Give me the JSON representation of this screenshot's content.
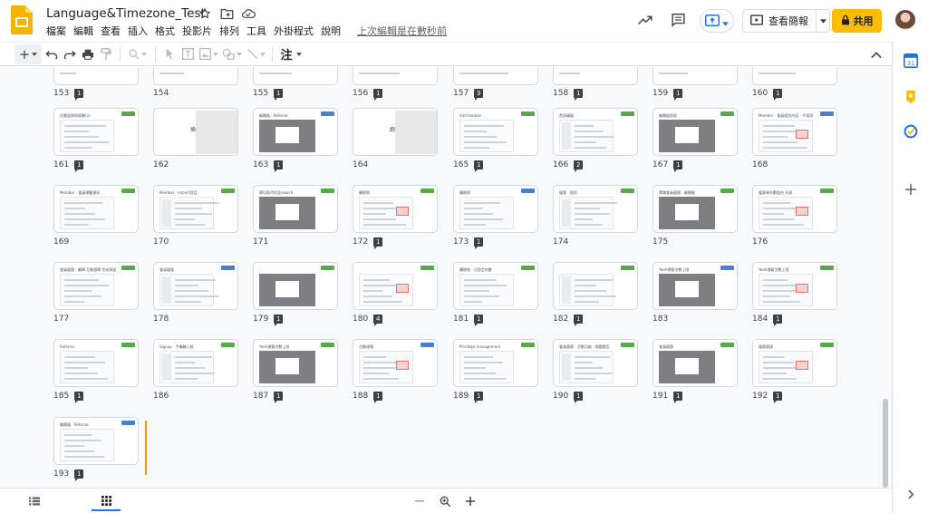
{
  "app": {
    "title": "Language&Timezone_Test",
    "last_edit": "上次編輯是在數秒前",
    "menu": [
      "檔案",
      "編輯",
      "查看",
      "插入",
      "格式",
      "投影片",
      "排列",
      "工具",
      "外掛程式",
      "說明"
    ]
  },
  "header": {
    "slideshow_label": "查看簡報",
    "share_label": "共用"
  },
  "toolbar": {
    "add_label": "+",
    "notes_label": "注"
  },
  "colors": {
    "accent": "#1a73e8",
    "share_button": "#fbbc04",
    "slides_logo": "#f4b400",
    "badge_green": "#57a847",
    "insert_line": "#f29900"
  },
  "icons": [
    "slides-logo-icon",
    "star-icon",
    "move-folder-icon",
    "cloud-status-icon",
    "activity-trend-icon",
    "comment-icon",
    "present-icon",
    "chevron-down-icon",
    "slideshow-icon",
    "lock-icon",
    "undo-icon",
    "redo-icon",
    "print-icon",
    "paint-format-icon",
    "zoom-icon",
    "select-icon",
    "textbox-icon",
    "image-icon",
    "shape-icon",
    "line-icon",
    "collapse-icon",
    "filmstrip-view-icon",
    "grid-view-icon",
    "zoom-out-icon",
    "zoom-in-icon",
    "calendar-icon",
    "keep-icon",
    "tasks-icon",
    "add-icon",
    "expand-panel-icon"
  ],
  "slides": [
    {
      "num": "153",
      "notes": "1"
    },
    {
      "num": "154",
      "notes": ""
    },
    {
      "num": "155",
      "notes": "1"
    },
    {
      "num": "156",
      "notes": "1"
    },
    {
      "num": "157",
      "notes": "3"
    },
    {
      "num": "158",
      "notes": "1"
    },
    {
      "num": "159",
      "notes": "1"
    },
    {
      "num": "160",
      "notes": "1"
    },
    {
      "num": "161",
      "notes": "1",
      "title": "在畫面按照兩顆(3)"
    },
    {
      "num": "162",
      "notes": "",
      "title": "換圖"
    },
    {
      "num": "163",
      "notes": "1",
      "title": "編輯器 · Referral"
    },
    {
      "num": "164",
      "notes": "",
      "title": "跑版"
    },
    {
      "num": "165",
      "notes": "1",
      "title": "Add module"
    },
    {
      "num": "166",
      "notes": "2",
      "title": "首頁橫幅"
    },
    {
      "num": "167",
      "notes": "1",
      "title": "編輯器版面"
    },
    {
      "num": "168",
      "notes": "",
      "title": "Member · 會員個別內容 · 不寫說"
    },
    {
      "num": "169",
      "notes": "",
      "title": "Member · 會員標籤資料"
    },
    {
      "num": "170",
      "notes": "",
      "title": "Member · import對話"
    },
    {
      "num": "171",
      "notes": "",
      "title": "單位取代的及search"
    },
    {
      "num": "172",
      "notes": "1",
      "title": "購物袋"
    },
    {
      "num": "173",
      "notes": "1",
      "title": "購物袋"
    },
    {
      "num": "174",
      "notes": "",
      "title": "優惠 · 個別"
    },
    {
      "num": "175",
      "notes": "",
      "title": "單獨會員優惠 · 編輯後"
    },
    {
      "num": "176",
      "notes": "",
      "title": "優惠券的數值合 共頁"
    },
    {
      "num": "177",
      "notes": "",
      "title": "會員優惠 · 編輯 互動選單 完成頁面"
    },
    {
      "num": "178",
      "notes": "",
      "title": "會員優惠"
    },
    {
      "num": "179",
      "notes": "1",
      "title": ""
    },
    {
      "num": "180",
      "notes": "4",
      "title": ""
    },
    {
      "num": "181",
      "notes": "1",
      "title": "購物袋 · 可設定的數"
    },
    {
      "num": "182",
      "notes": "1",
      "title": ""
    },
    {
      "num": "183",
      "notes": "",
      "title": "Yeoh標簽字數上限"
    },
    {
      "num": "184",
      "notes": "1",
      "title": "Yeoh標簽字數上限"
    },
    {
      "num": "185",
      "notes": "1",
      "title": "Referral"
    },
    {
      "num": "186",
      "notes": "",
      "title": "Signup · 手機輸入框"
    },
    {
      "num": "187",
      "notes": "1",
      "title": "Yeoh標簽字數上限"
    },
    {
      "num": "188",
      "notes": "1",
      "title": "活動現場"
    },
    {
      "num": "189",
      "notes": "1",
      "title": "Privilege management"
    },
    {
      "num": "190",
      "notes": "1",
      "title": "會員優惠 · 活動功能 · 標題模型"
    },
    {
      "num": "191",
      "notes": "1",
      "title": "會員優惠"
    },
    {
      "num": "192",
      "notes": "1",
      "title": "優惠實錄"
    },
    {
      "num": "193",
      "notes": "1",
      "title": "編輯器 · Referral"
    }
  ]
}
